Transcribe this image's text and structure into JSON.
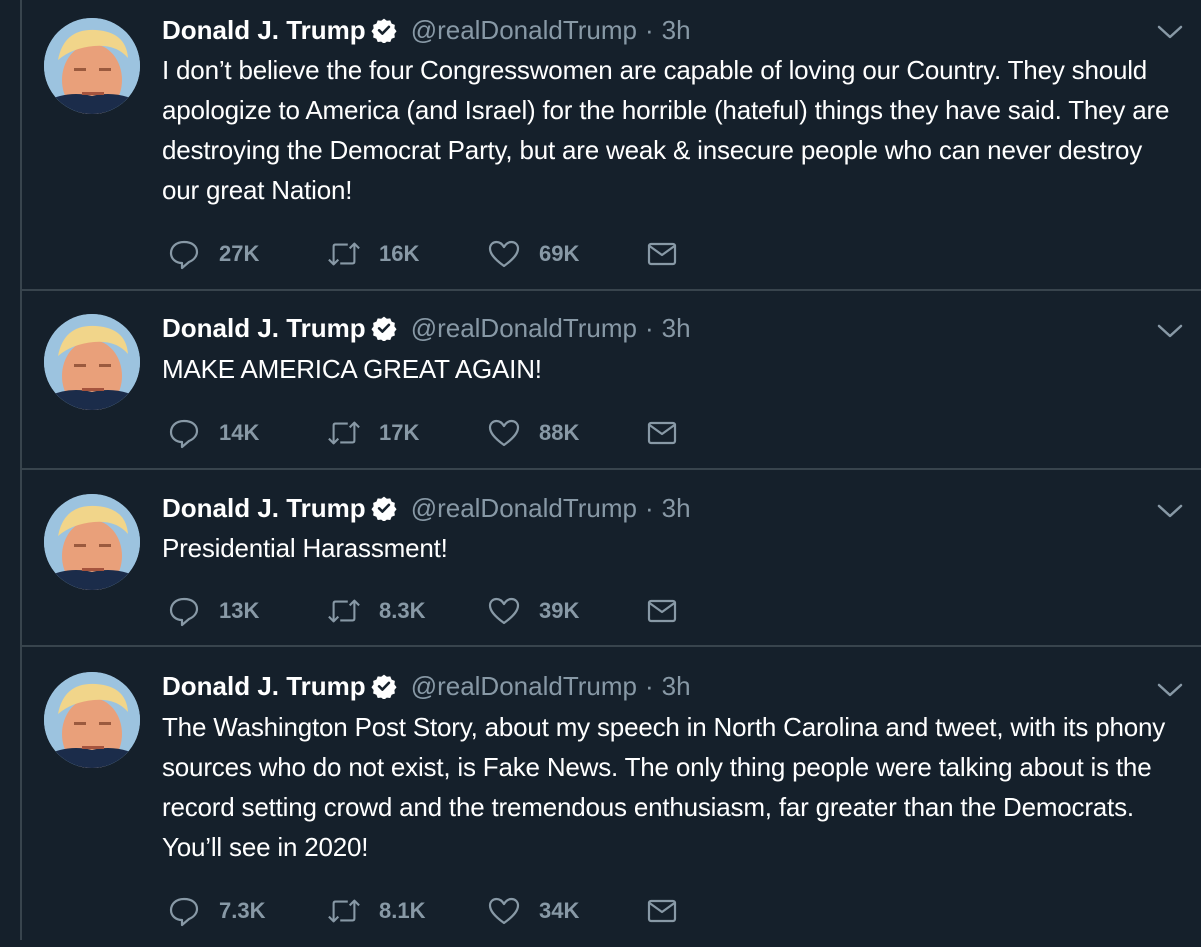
{
  "tweets": [
    {
      "name": "Donald J. Trump",
      "handle": "@realDonaldTrump",
      "dot": "·",
      "time": "3h",
      "text": "I don’t believe the four Congresswomen are capable of loving our Country. They should apologize to America (and Israel) for the horrible (hateful) things they have said. They are destroying the Democrat Party, but are weak & insecure people who can never destroy our great Nation!",
      "replies": "27K",
      "retweets": "16K",
      "likes": "69K"
    },
    {
      "name": "Donald J. Trump",
      "handle": "@realDonaldTrump",
      "dot": "·",
      "time": "3h",
      "text": "MAKE AMERICA GREAT AGAIN!",
      "replies": "14K",
      "retweets": "17K",
      "likes": "88K"
    },
    {
      "name": "Donald J. Trump",
      "handle": "@realDonaldTrump",
      "dot": "·",
      "time": "3h",
      "text": "Presidential Harassment!",
      "replies": "13K",
      "retweets": "8.3K",
      "likes": "39K"
    },
    {
      "name": "Donald J. Trump",
      "handle": "@realDonaldTrump",
      "dot": "·",
      "time": "3h",
      "text": "The Washington Post Story, about my speech in North Carolina and tweet, with its phony sources who do not exist, is Fake News. The only thing people were talking about is the record setting crowd and the tremendous enthusiasm, far greater than the Democrats. You’ll see in 2020!",
      "replies": "7.3K",
      "retweets": "8.1K",
      "likes": "34K"
    }
  ],
  "icons": {
    "verified": "verified-badge-icon",
    "caret": "chevron-down-icon",
    "reply": "reply-icon",
    "retweet": "retweet-icon",
    "like": "heart-icon",
    "dm": "envelope-icon"
  },
  "colors": {
    "background": "#15202b",
    "border": "#38444d",
    "secondary_text": "#8899a6",
    "primary_text": "#ffffff"
  }
}
